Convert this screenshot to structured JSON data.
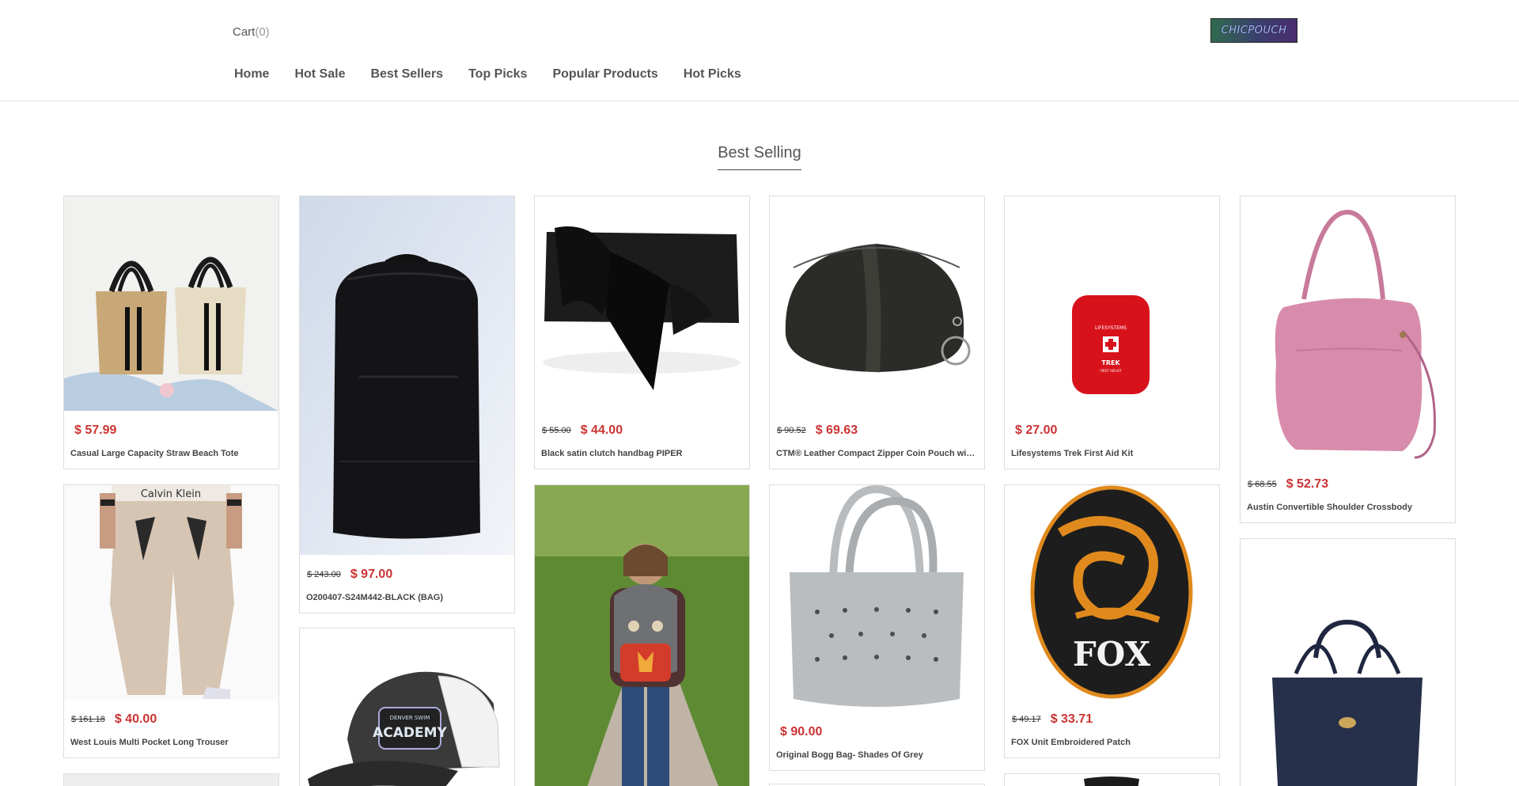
{
  "header": {
    "cart_label": "Cart",
    "cart_count": "(0)",
    "logo_text": "CHICPOUCH",
    "nav": [
      "Home",
      "Hot Sale",
      "Best Sellers",
      "Top Picks",
      "Popular Products",
      "Hot Picks"
    ]
  },
  "section": {
    "title": "Best Selling"
  },
  "products": [
    {
      "name": "Casual Large Capacity Straw Beach Tote",
      "old_price": "",
      "price": "$ 57.99"
    },
    {
      "name": "O200407-S24M442-BLACK (BAG)",
      "old_price": "$ 243.00",
      "price": "$ 97.00"
    },
    {
      "name": "Black satin clutch handbag PIPER",
      "old_price": "$ 55.00",
      "price": "$ 44.00"
    },
    {
      "name": "CTM® Leather Compact Zipper Coin Pouch with Key Ring",
      "old_price": "$ 90.52",
      "price": "$ 69.63"
    },
    {
      "name": "Lifesystems Trek First Aid Kit",
      "old_price": "",
      "price": "$ 27.00"
    },
    {
      "name": "Austin Convertible Shoulder Crossbody",
      "old_price": "$ 68.55",
      "price": "$ 52.73"
    },
    {
      "name": "West Louis Multi Pocket Long Trouser",
      "old_price": "$ 161.18",
      "price": "$ 40.00"
    },
    {
      "name": "Original Bogg Bag- Shades Of Grey",
      "old_price": "",
      "price": "$ 90.00"
    },
    {
      "name": "FOX Unit Embroidered Patch",
      "old_price": "$ 49.17",
      "price": "$ 33.71"
    }
  ],
  "image_texts": {
    "firstaid_brand": "LIFESYSTEMS",
    "firstaid_model": "TREK",
    "firstaid_sub": "FIRST AID KIT",
    "trouser_brand": "Calvin Klein",
    "patch_text": "FOX",
    "cap_text": "ACADEMY",
    "cap_small": "DENVER SWIM"
  },
  "colors": {
    "price": "#cc3333",
    "accent": "#555555"
  }
}
